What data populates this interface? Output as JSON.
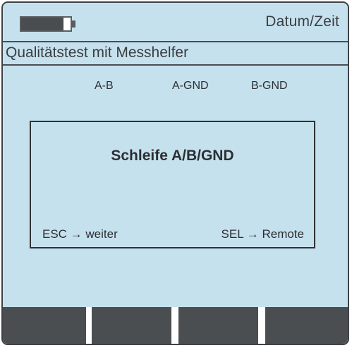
{
  "status_bar": {
    "battery_level": 0.85,
    "datetime_label": "Datum/Zeit"
  },
  "title_bar": {
    "title": "Qualitätstest mit Messhelfer"
  },
  "tests": [
    {
      "label": "A-B"
    },
    {
      "label": "A-GND"
    },
    {
      "label": "B-GND"
    }
  ],
  "dialog": {
    "title": "Schleife A/B/GND",
    "esc_hint": "ESC → weiter",
    "sel_hint": "SEL → Remote"
  },
  "softkeys": [
    {
      "label": ""
    },
    {
      "label": ""
    },
    {
      "label": ""
    },
    {
      "label": ""
    }
  ],
  "colors": {
    "screen_background": "#c6e1ee",
    "frame": "#3f4245",
    "softkey": "#4b4e51",
    "text": "#2c2f32"
  }
}
